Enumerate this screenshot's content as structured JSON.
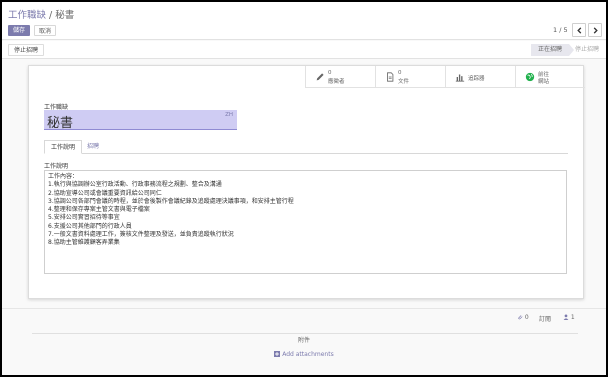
{
  "breadcrumb": {
    "parent": "工作職缺",
    "separator": " / ",
    "current": "秘書"
  },
  "toolbar": {
    "save_label": "儲存",
    "discard_label": "取消"
  },
  "pager": {
    "value": "1 / 5"
  },
  "statusbar": {
    "stop_label": "停止招聘",
    "stage_active": "正在招聘",
    "stage_inactive": "停止招聘"
  },
  "smart_buttons": {
    "applications": {
      "count": "0",
      "label": "應徵者",
      "icon": "pencil-icon"
    },
    "documents": {
      "count": "0",
      "label": "文件",
      "icon": "file-icon"
    },
    "report": {
      "label": "追踪器",
      "icon": "bar-chart-icon"
    },
    "website": {
      "label_line1": "前往",
      "label_line2": "網站",
      "icon": "globe-icon"
    }
  },
  "form": {
    "job_label": "工作職缺",
    "job_value": "秘書",
    "lang_badge": "ZH",
    "tabs": [
      "工作說明",
      "招聘"
    ],
    "desc_label": "工作說明",
    "desc_lines": [
      "工作內容：",
      "1.執行與協調辦公室行政活動、行政事務流程之規劃、整合及溝通",
      "2.協助宣導公司或會議重要資訊給公司同仁",
      "3.協調公司各部門會議的時程，並於會後製作會議紀錄及追蹤處理決議事項，和安排主管行程",
      "4.整理和保存專案主管文書與電子檔案",
      "5.安排公司實習招待等事宜",
      "6.支援公司其他部門的行政人員",
      "7.一般文書資料處理工作，簽核文件整理及發送，並負責追蹤執行狀況",
      "8.協助主管維護顧客弄業集"
    ]
  },
  "chatter": {
    "message_count": "0",
    "follow_label": "訂閱",
    "follower_count": "1",
    "attachments_title": "附件",
    "add_attachments": "Add attachments"
  },
  "colors": {
    "primary": "#7c7bad",
    "input_bg": "#cfccf3"
  }
}
